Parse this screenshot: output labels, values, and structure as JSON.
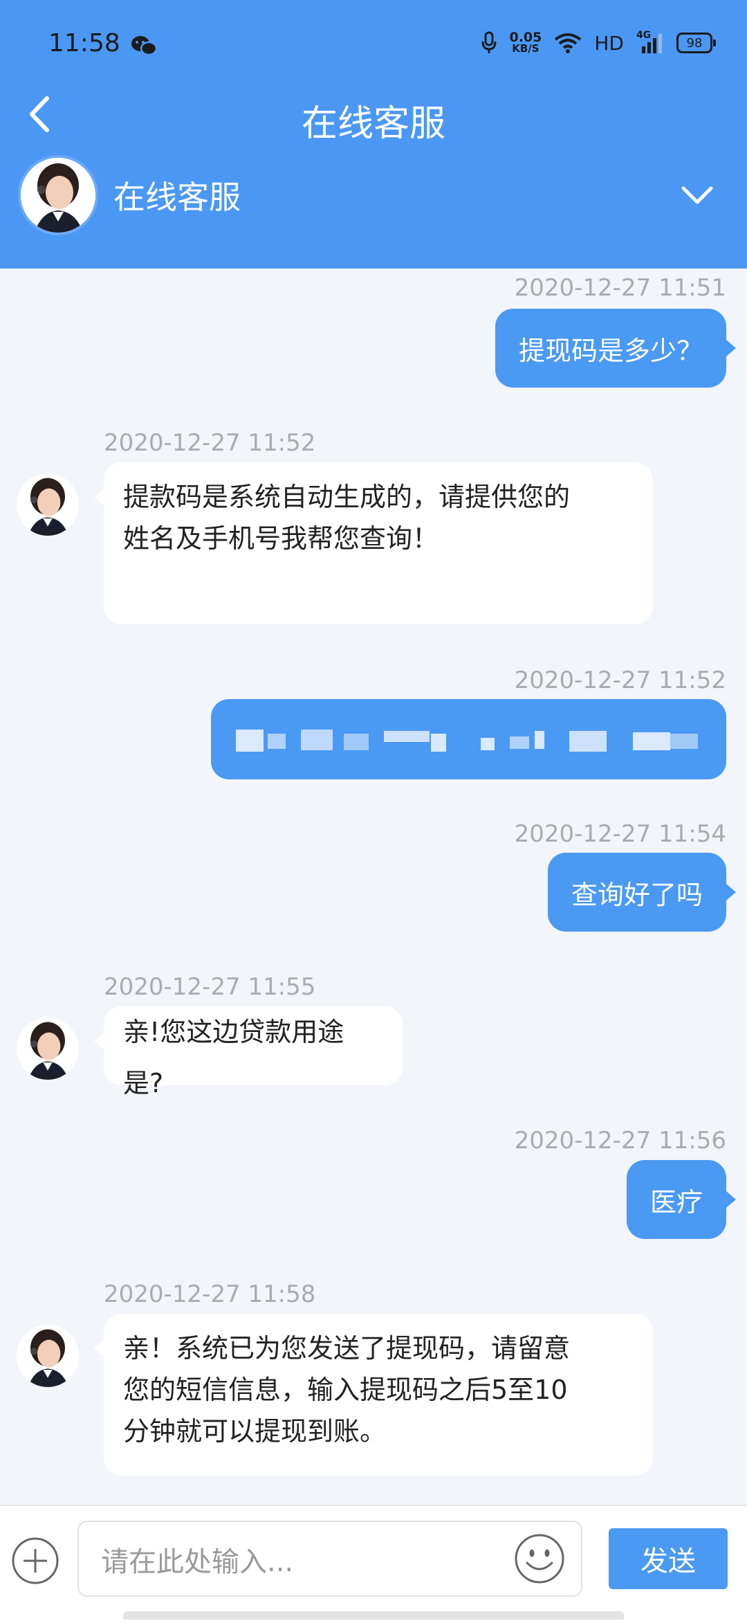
{
  "status_bar": {
    "time": "11:58",
    "net_speed_value": "0.05",
    "net_speed_unit": "KB/S",
    "hd": "HD",
    "signal_label": "4G",
    "battery": "98"
  },
  "header": {
    "title": "在线客服",
    "agent_name": "在线客服"
  },
  "messages": [
    {
      "side": "right",
      "time": "2020-12-27 11:51",
      "text": "提现码是多少？"
    },
    {
      "side": "left",
      "time": "2020-12-27 11:52",
      "lines": [
        "提款码是系统自动生成的，请提供您的",
        "姓名及手机号我帮您查询！"
      ]
    },
    {
      "side": "right",
      "time": "2020-12-27 11:52",
      "text": ""
    },
    {
      "side": "right",
      "time": "2020-12-27 11:54",
      "text": "查询好了吗"
    },
    {
      "side": "left",
      "time": "2020-12-27 11:55",
      "lines": [
        "亲!您这边贷款用途是?"
      ]
    },
    {
      "side": "right",
      "time": "2020-12-27 11:56",
      "text": "医疗"
    },
    {
      "side": "left",
      "time": "2020-12-27 11:58",
      "lines": [
        "亲！系统已为您发送了提现码，请留意",
        "您的短信信息，输入提现码之后5至10",
        "分钟就可以提现到账。"
      ]
    }
  ],
  "input": {
    "placeholder": "请在此处输入...",
    "send_label": "发送"
  },
  "colors": {
    "header_bg": "#4b98f4",
    "bubble_out": "#4a99f3",
    "bubble_in": "#ffffff",
    "page_bg": "#f2f5fa"
  }
}
